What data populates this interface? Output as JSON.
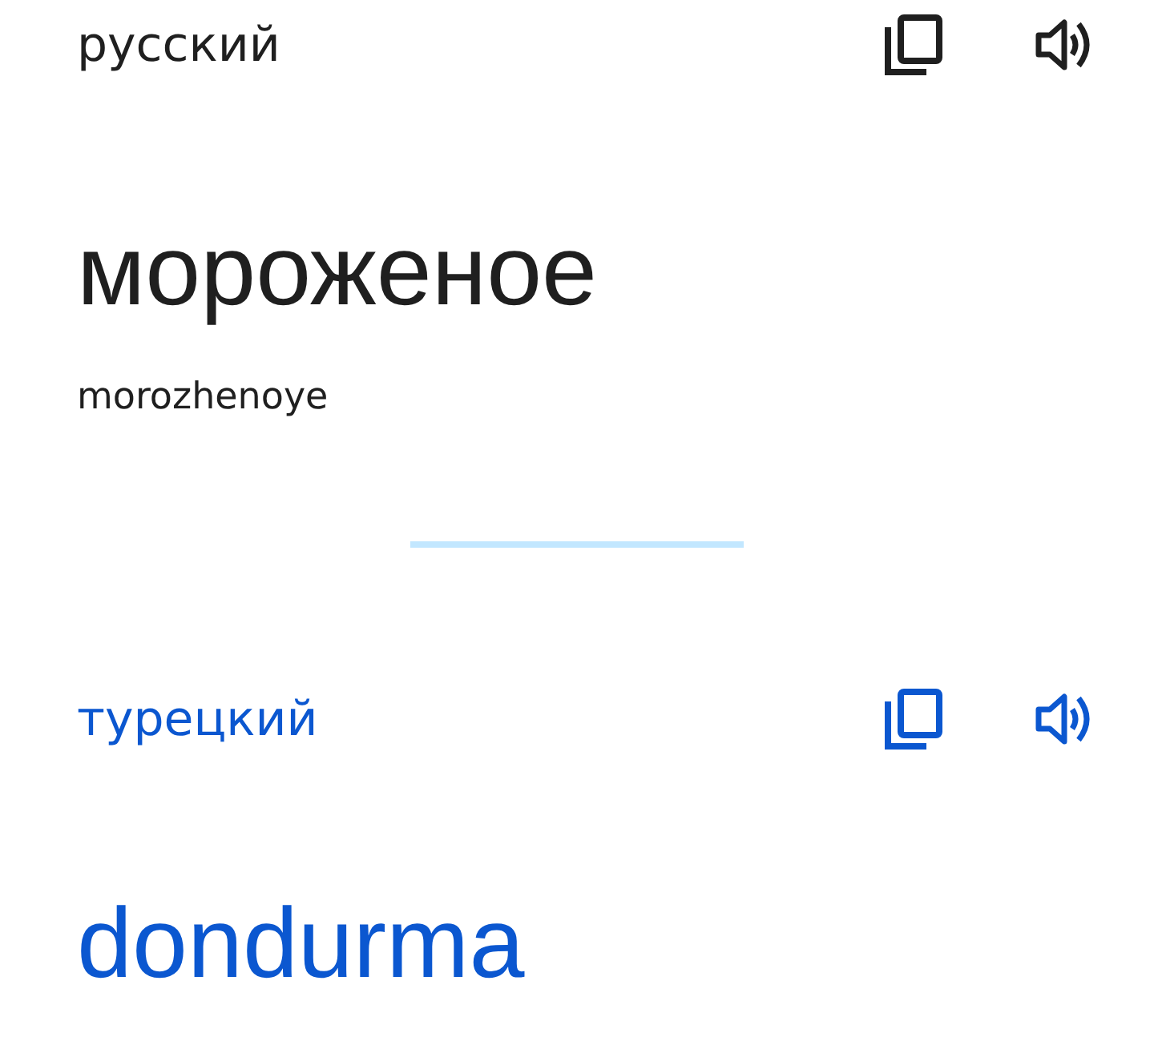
{
  "sections": [
    {
      "kind": "source",
      "language": "русский",
      "text": "мороженое",
      "transliteration": "morozhenoye"
    },
    {
      "kind": "target",
      "language": "турецкий",
      "text": "dondurma"
    }
  ]
}
